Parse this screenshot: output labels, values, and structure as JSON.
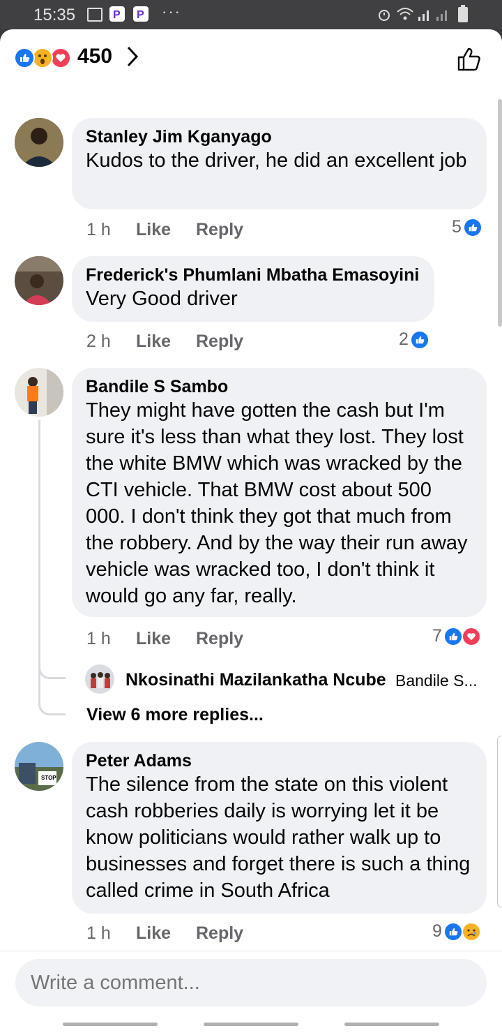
{
  "status": {
    "time": "15:35"
  },
  "header": {
    "reaction_count": "450",
    "reactions": [
      "like-icon",
      "wow-icon",
      "love-icon"
    ]
  },
  "comments": [
    {
      "author": "Stanley Jim Kganyago",
      "text": "Kudos to the driver, he did an excellent job",
      "time": "1 h",
      "like": "Like",
      "reply": "Reply",
      "reaction_count": "5",
      "reactions": [
        "like-icon"
      ]
    },
    {
      "author": "Frederick's Phumlani Mbatha Emasoyini",
      "text": "Very Good driver",
      "time": "2 h",
      "like": "Like",
      "reply": "Reply",
      "reaction_count": "2",
      "reactions": [
        "like-icon"
      ]
    },
    {
      "author": "Bandile S Sambo",
      "text": "They might have gotten the cash but I'm sure it's less than what they lost. They lost the white BMW which was wracked by the CTI vehicle. That BMW cost about 500 000. I don't think they got that much from the robbery. And by the way their run away vehicle was wracked too, I don't think it would go any far, really.",
      "time": "1 h",
      "like": "Like",
      "reply": "Reply",
      "reaction_count": "7",
      "reactions": [
        "like-icon",
        "love-icon"
      ],
      "reply_preview": {
        "author": "Nkosinathi Mazilankatha Ncube",
        "snippet": "Bandile S..."
      },
      "more_replies": "View 6 more replies..."
    },
    {
      "author": "Peter Adams",
      "text": "The silence from the state on this violent cash robberies daily is worrying let it be know politicians would rather walk up to businesses and forget there is such a thing called crime in South Africa",
      "time": "1 h",
      "like": "Like",
      "reply": "Reply",
      "reaction_count": "9",
      "reactions": [
        "like-icon",
        "sad-icon"
      ]
    }
  ],
  "composer": {
    "placeholder": "Write a comment..."
  },
  "colors": {
    "like": "#1877f2",
    "love": "#f33e58",
    "wow": "#f7b125",
    "bubble": "#eff1f4",
    "meta": "#65676b"
  }
}
